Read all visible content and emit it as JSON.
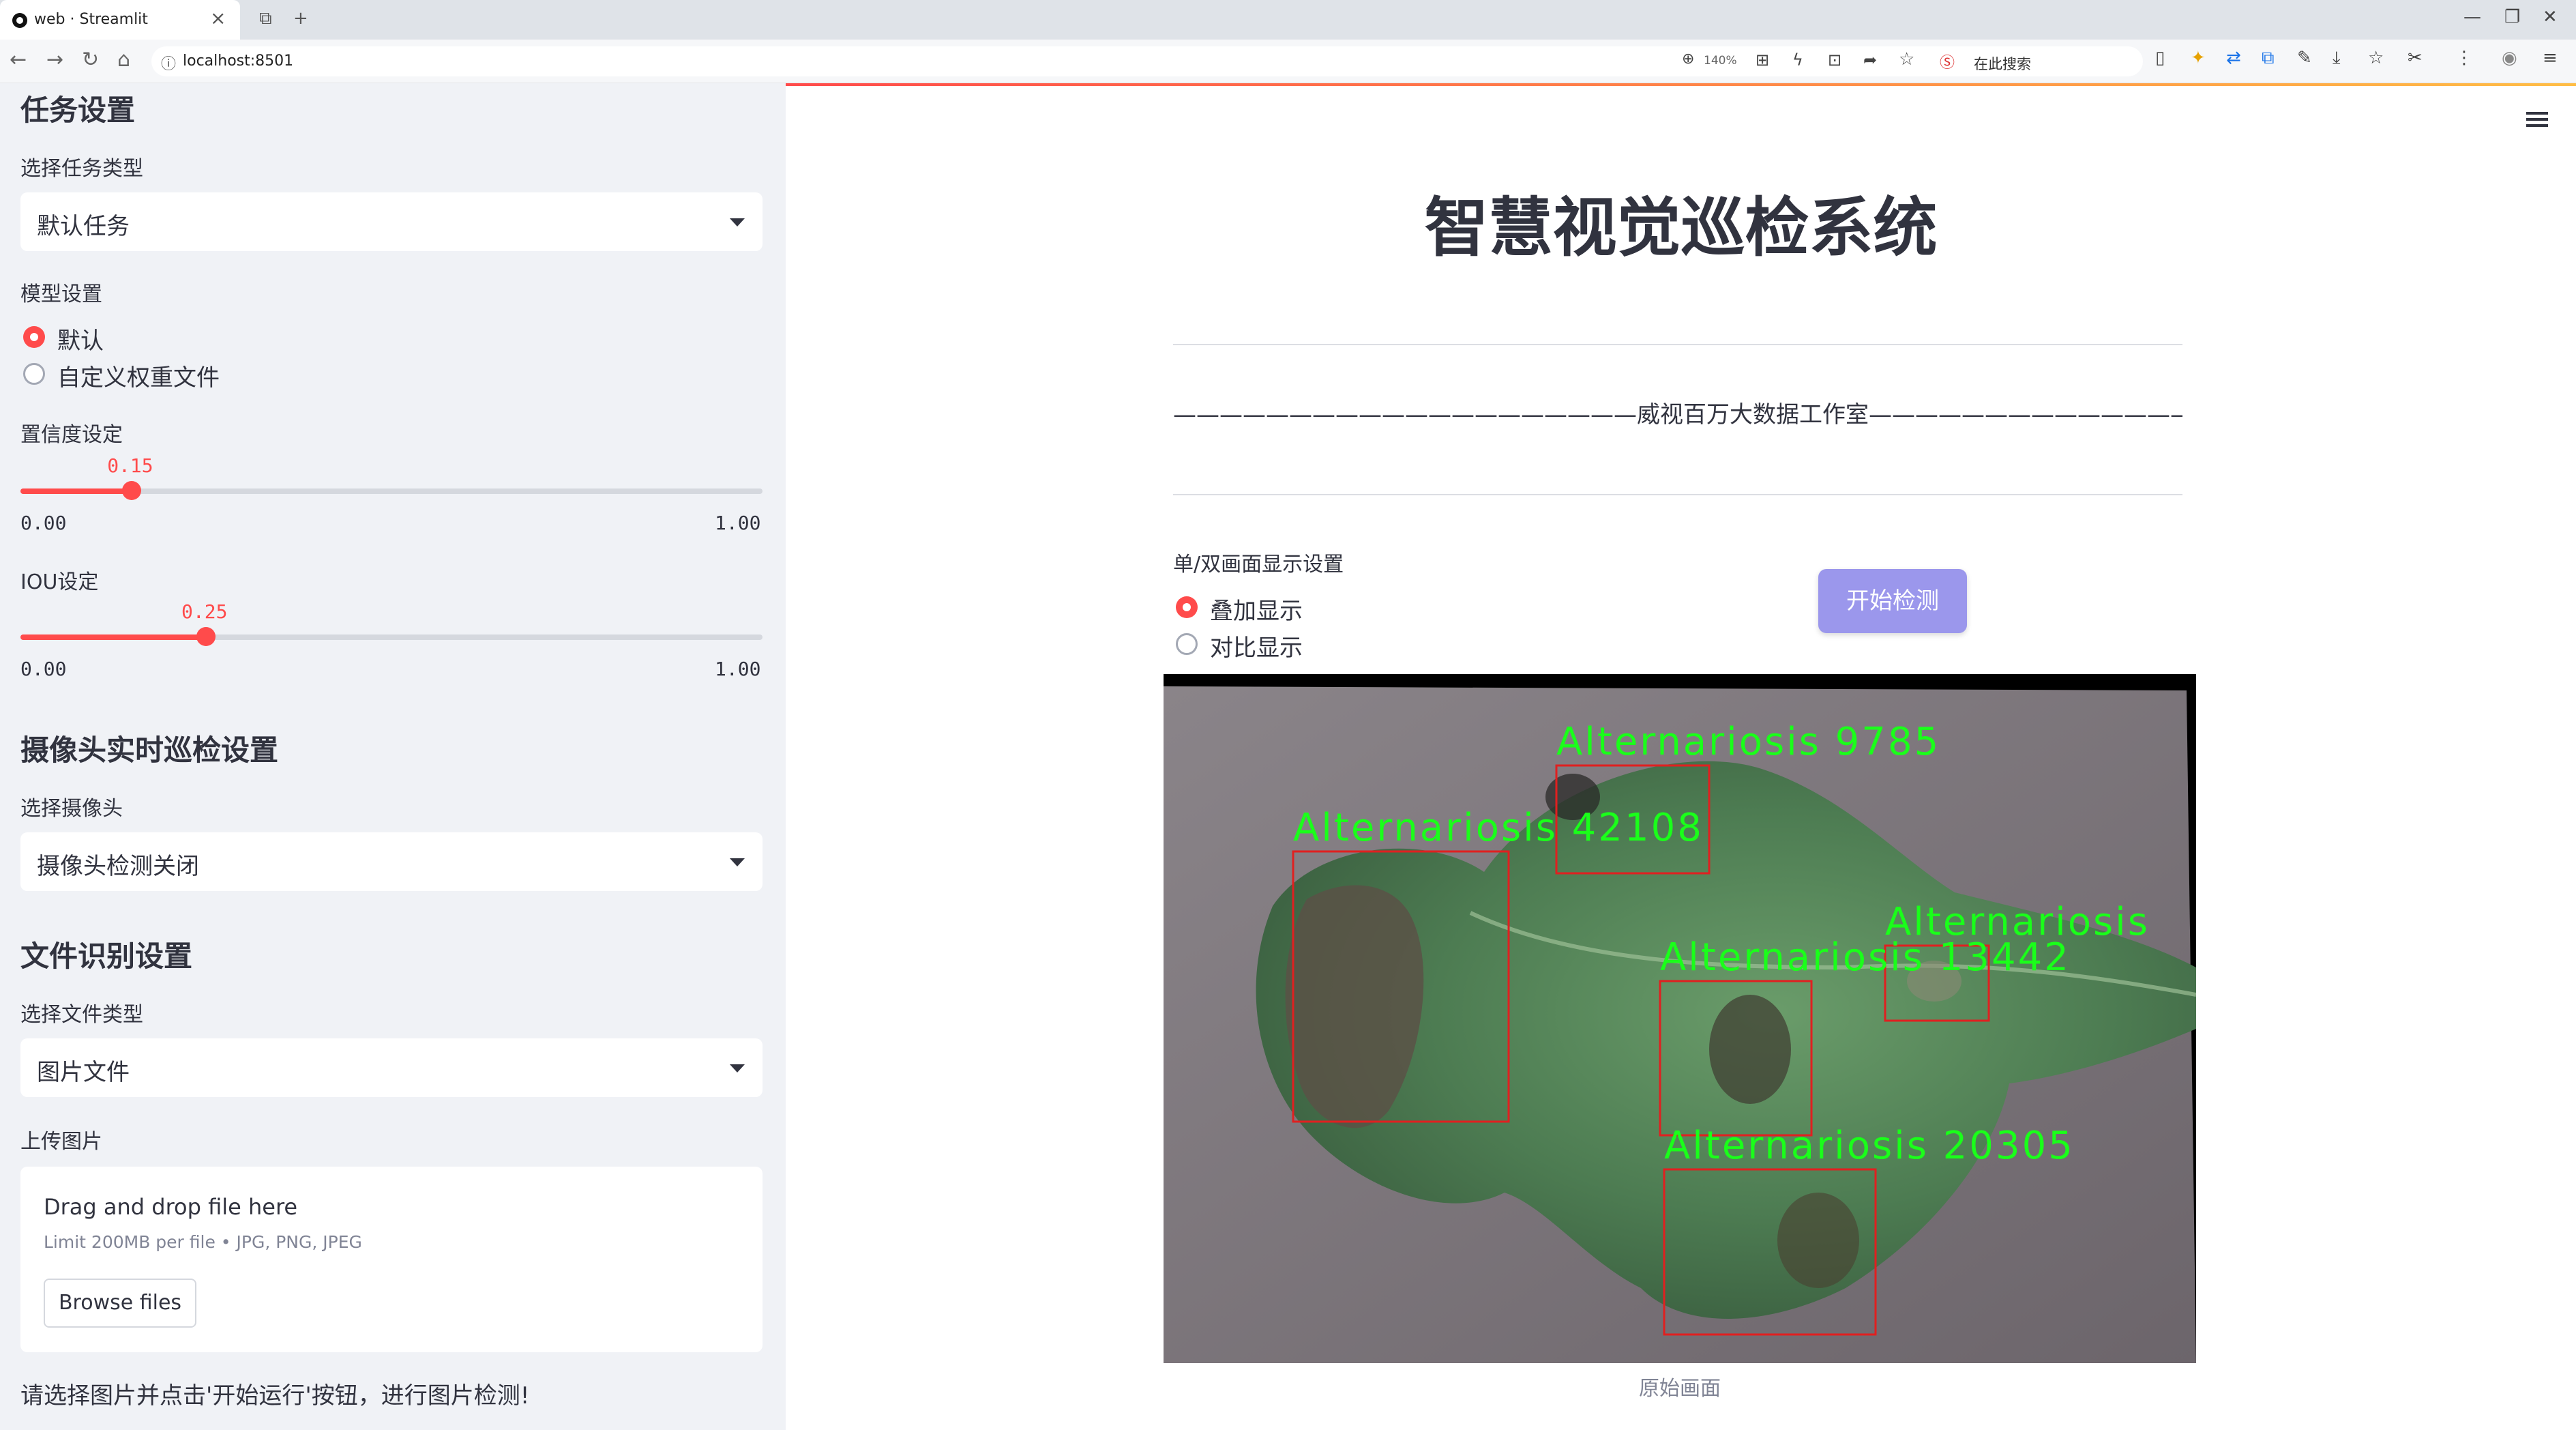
{
  "browser": {
    "tab_title": "web · Streamlit",
    "tab_close": "×",
    "new_tab": "+",
    "url": "localhost:8501",
    "zoom": "140%",
    "search_placeholder": "在此搜索"
  },
  "sidebar": {
    "task_header": "任务设置",
    "task_type_label": "选择任务类型",
    "task_type_value": "默认任务",
    "model_label": "模型设置",
    "model_options": [
      {
        "label": "默认",
        "selected": true
      },
      {
        "label": "自定义权重文件",
        "selected": false
      }
    ],
    "confidence": {
      "label": "置信度设定",
      "value": "0.15",
      "fraction": 0.15,
      "min": "0.00",
      "max": "1.00"
    },
    "iou": {
      "label": "IOU设定",
      "value": "0.25",
      "fraction": 0.25,
      "min": "0.00",
      "max": "1.00"
    },
    "camera_header": "摄像头实时巡检设置",
    "camera_label": "选择摄像头",
    "camera_value": "摄像头检测关闭",
    "file_header": "文件识别设置",
    "file_type_label": "选择文件类型",
    "file_type_value": "图片文件",
    "upload_label": "上传图片",
    "uploader": {
      "title": "Drag and drop file here",
      "limit": "Limit 200MB per file • JPG, PNG, JPEG",
      "button": "Browse files"
    },
    "hint": "请选择图片并点击'开始运行'按钮，进行图片检测!"
  },
  "main": {
    "title": "智慧视觉巡检系统",
    "studio": "————————————————————威视百万大数据工作室—————————————————————",
    "display_label": "单/双画面显示设置",
    "display_options": [
      {
        "label": "叠加显示",
        "selected": true
      },
      {
        "label": "对比显示",
        "selected": false
      }
    ],
    "start_button": "开始检测",
    "caption": "原始画面",
    "detections": [
      {
        "label": "Alternariosis 9785"
      },
      {
        "label": "Alternariosis 42108"
      },
      {
        "label": "Alternariosis"
      },
      {
        "label": "Alternariosis 13442"
      },
      {
        "label": "Alternariosis 20305"
      }
    ]
  },
  "colors": {
    "accent": "#ff4b4b",
    "button": "#9b97ec",
    "sidebar_bg": "#f0f2f6",
    "box": "#e02020",
    "box_label": "#1aff1a"
  }
}
